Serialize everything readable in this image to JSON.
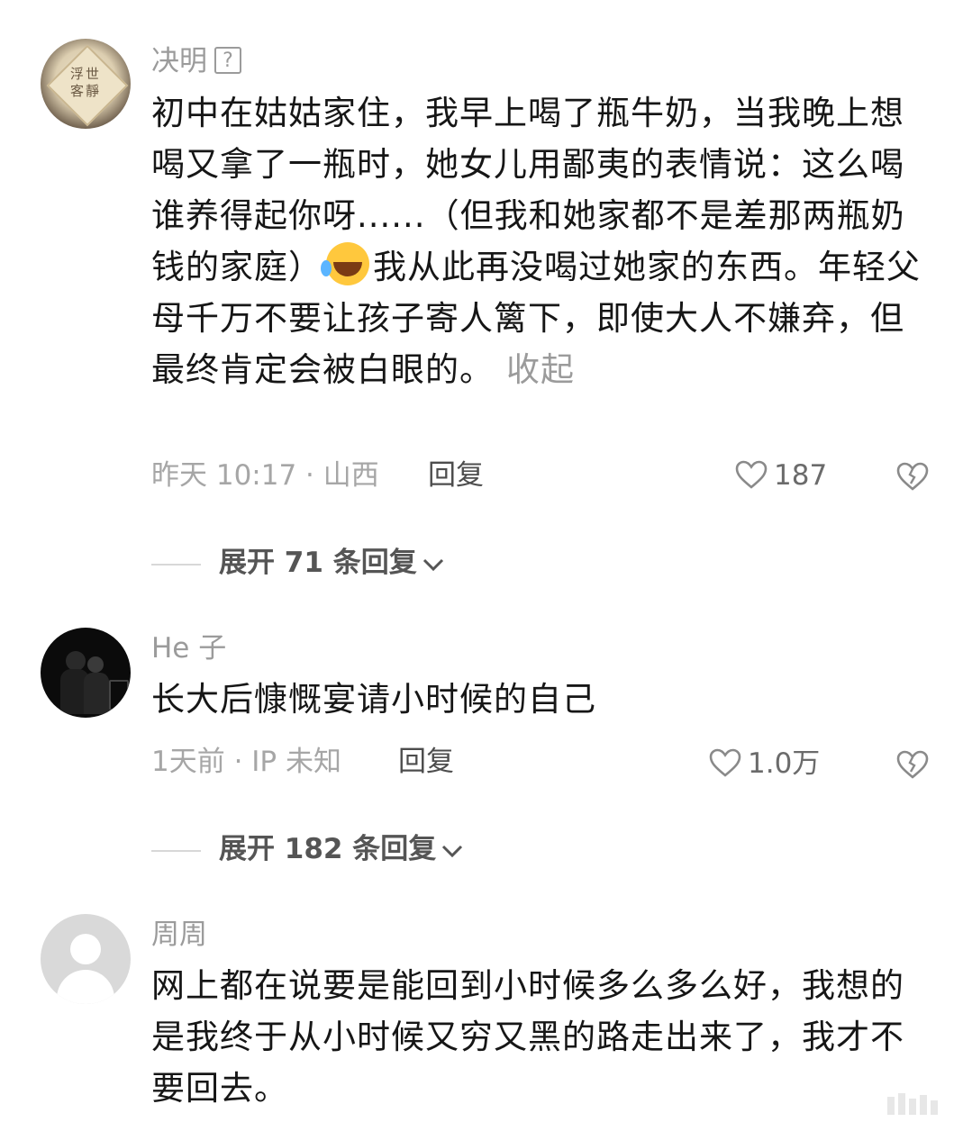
{
  "comments": [
    {
      "username": "决明",
      "badge_icon": "question-mark-icon",
      "avatar_text": "浮世\n客靜",
      "body_lines_before_emoji": "初中在姑姑家住，我早上喝了瓶牛奶，当我晚上想喝又拿了一瓶时，她女儿用鄙夷的表情说：这么喝谁养得起你呀......（但我和她家都不是差那两瓶奶钱的家庭）",
      "emoji": "rolling-on-floor-laughing-emoji",
      "body_after_emoji": "我从此再没喝过她家的东西。年轻父母千万不要让孩子寄人篱下，即使大人不嫌弃，但最终肯定会被白眼的。",
      "collapse_label": "收起",
      "meta": "昨天 10:17 · 山西",
      "reply_label": "回复",
      "like_count": "187",
      "expand_label": "展开 71 条回复"
    },
    {
      "username": "He 子",
      "body": "长大后慷慨宴请小时候的自己",
      "meta": "1天前 · IP 未知",
      "reply_label": "回复",
      "like_count": "1.0万",
      "expand_label": "展开 182 条回复"
    },
    {
      "username": "周周",
      "body": "网上都在说要是能回到小时候多么多么好，我想的是我终于从小时候又穷又黑的路走出来了，我才不要回去。"
    }
  ]
}
